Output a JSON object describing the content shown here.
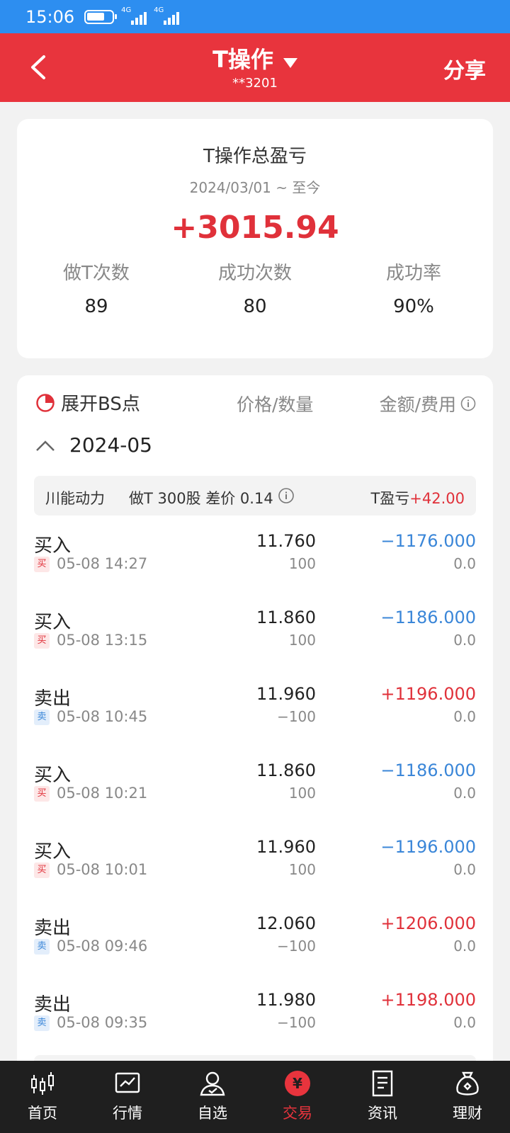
{
  "status": {
    "time": "15:06",
    "net1": "4G",
    "net2": "4G"
  },
  "header": {
    "title": "T操作",
    "account": "**3201",
    "share": "分享"
  },
  "summary": {
    "title": "T操作总盈亏",
    "date_range": "2024/03/01 ~ 至今",
    "total": "+3015.94",
    "stats": [
      {
        "label": "做T次数",
        "value": "89"
      },
      {
        "label": "成功次数",
        "value": "80"
      },
      {
        "label": "成功率",
        "value": "90%"
      }
    ]
  },
  "detail": {
    "bs_label": "展开BS点",
    "col_price": "价格/数量",
    "col_amount": "金额/费用",
    "month": "2024-05",
    "group": {
      "stock": "川能动力",
      "info": "做T 300股 差价 0.14",
      "pl_label": "T盈亏",
      "pl_value": "+42.00"
    },
    "trades": [
      {
        "type": "买入",
        "badge": "买",
        "time": "05-08 14:27",
        "price": "11.760",
        "qty": "100",
        "amount": "−1176.000",
        "fee": "0.0"
      },
      {
        "type": "买入",
        "badge": "买",
        "time": "05-08 13:15",
        "price": "11.860",
        "qty": "100",
        "amount": "−1186.000",
        "fee": "0.0"
      },
      {
        "type": "卖出",
        "badge": "卖",
        "time": "05-08 10:45",
        "price": "11.960",
        "qty": "−100",
        "amount": "+1196.000",
        "fee": "0.0"
      },
      {
        "type": "买入",
        "badge": "买",
        "time": "05-08 10:21",
        "price": "11.860",
        "qty": "100",
        "amount": "−1186.000",
        "fee": "0.0"
      },
      {
        "type": "买入",
        "badge": "买",
        "time": "05-08 10:01",
        "price": "11.960",
        "qty": "100",
        "amount": "−1196.000",
        "fee": "0.0"
      },
      {
        "type": "卖出",
        "badge": "卖",
        "time": "05-08 09:46",
        "price": "12.060",
        "qty": "−100",
        "amount": "+1206.000",
        "fee": "0.0"
      },
      {
        "type": "卖出",
        "badge": "卖",
        "time": "05-08 09:35",
        "price": "11.980",
        "qty": "−100",
        "amount": "+1198.000",
        "fee": "0.0"
      }
    ]
  },
  "nav": [
    {
      "label": "首页",
      "icon": "candlestick-icon"
    },
    {
      "label": "行情",
      "icon": "chart-icon"
    },
    {
      "label": "自选",
      "icon": "person-icon"
    },
    {
      "label": "交易",
      "icon": "yuan-icon"
    },
    {
      "label": "资讯",
      "icon": "document-icon"
    },
    {
      "label": "理财",
      "icon": "money-bag-icon"
    }
  ],
  "colors": {
    "brand_red": "#e8343d",
    "status_blue": "#2d8ef0",
    "loss_blue": "#3a86d8",
    "gain_red": "#e0313a"
  }
}
